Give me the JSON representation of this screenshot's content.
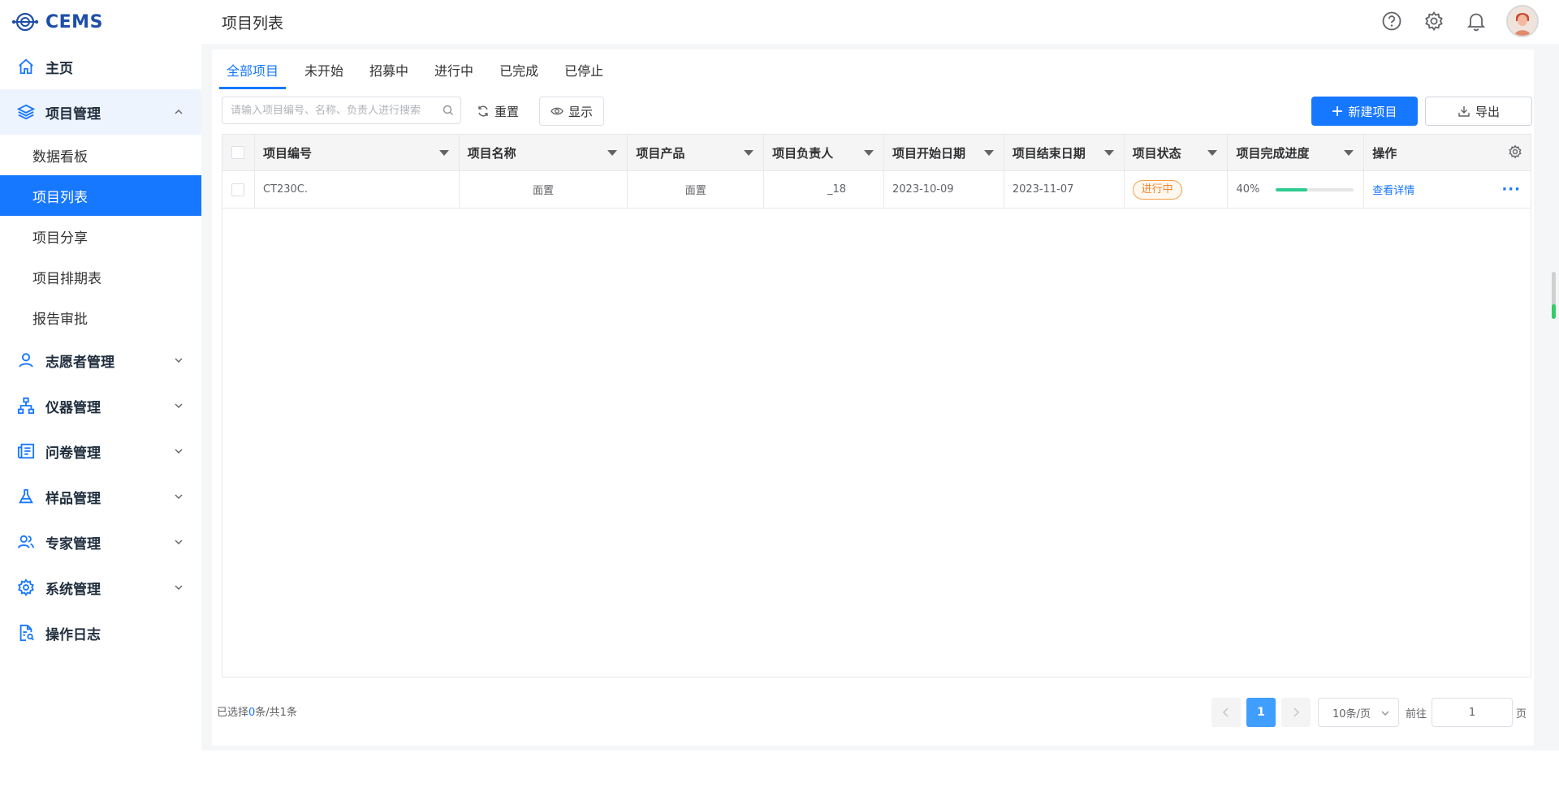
{
  "app": {
    "logo_text": "CEMS",
    "page_title": "项目列表"
  },
  "sidebar": {
    "items": [
      {
        "label": "主页",
        "icon": "home-icon"
      },
      {
        "label": "项目管理",
        "icon": "layers-icon",
        "expanded": true,
        "children": [
          "数据看板",
          "项目列表",
          "项目分享",
          "项目排期表",
          "报告审批"
        ],
        "active_child": "项目列表"
      },
      {
        "label": "志愿者管理",
        "icon": "user-icon"
      },
      {
        "label": "仪器管理",
        "icon": "sitemap-icon"
      },
      {
        "label": "问卷管理",
        "icon": "newspaper-icon"
      },
      {
        "label": "样品管理",
        "icon": "flask-icon"
      },
      {
        "label": "专家管理",
        "icon": "users-icon"
      },
      {
        "label": "系统管理",
        "icon": "gear-icon"
      },
      {
        "label": "操作日志",
        "icon": "doc-search-icon"
      }
    ]
  },
  "tabs": [
    "全部项目",
    "未开始",
    "招募中",
    "进行中",
    "已完成",
    "已停止"
  ],
  "active_tab": "全部项目",
  "toolbar": {
    "search_placeholder": "请输入项目编号、名称、负责人进行搜索",
    "reset_label": "重置",
    "show_label": "显示",
    "new_label": "新建项目",
    "export_label": "导出"
  },
  "table": {
    "columns": [
      "项目编号",
      "项目名称",
      "项目产品",
      "项目负责人",
      "项目开始日期",
      "项目结束日期",
      "项目状态",
      "项目完成进度",
      "操作"
    ],
    "rows": [
      {
        "code": "CT230C.",
        "name": "面置",
        "product": "面置",
        "owner": "_18",
        "start": "2023-10-09",
        "end": "2023-11-07",
        "status": "进行中",
        "progress_text": "40%",
        "progress": 0.4,
        "action": "查看详情",
        "more": "···"
      }
    ]
  },
  "footer": {
    "selected_prefix": "已选择",
    "selected_count": "0",
    "selected_suffix": "条/共1条",
    "current_page": "1",
    "page_size": "10条/页",
    "goto_label": "前往",
    "goto_value": "1",
    "page_suffix": "页"
  },
  "colors": {
    "primary": "#1677ff",
    "status_orange": "#f5832b",
    "progress_green": "#2ecc8f"
  }
}
